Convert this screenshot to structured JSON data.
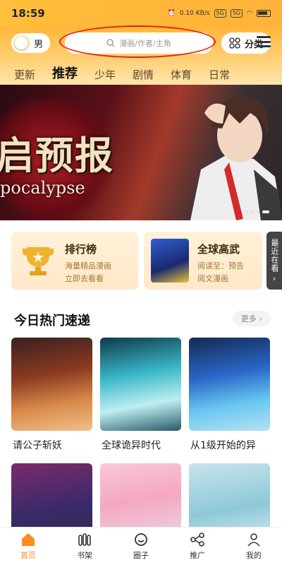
{
  "status": {
    "time": "18:59",
    "net_speed": "0.10 KB/s",
    "sig1": "5G",
    "sig2": "5G"
  },
  "header": {
    "gender_label": "男",
    "search_placeholder": "漫画/作者/主角",
    "category_label": "分类"
  },
  "tabs": [
    {
      "label": "更新"
    },
    {
      "label": "推荐"
    },
    {
      "label": "少年"
    },
    {
      "label": "剧情"
    },
    {
      "label": "体育"
    },
    {
      "label": "日常"
    }
  ],
  "banner": {
    "title": "启预报",
    "subtitle": "pocalypse"
  },
  "cards": {
    "ranking": {
      "title": "排行榜",
      "line1": "海量精品漫画",
      "line2": "立即去看看"
    },
    "promo": {
      "title": "全球高武",
      "line1": "阅读至：预告",
      "line2": "阅文漫画"
    },
    "recent_label": "最近在看"
  },
  "section": {
    "title": "今日热门速递",
    "more_label": "更多"
  },
  "comics": [
    {
      "title": "请公子斩妖"
    },
    {
      "title": "全球诡异时代"
    },
    {
      "title": "从1级开始的异"
    },
    {
      "title": ""
    },
    {
      "title": ""
    },
    {
      "title": ""
    }
  ],
  "nav": [
    {
      "label": "首页",
      "active": true
    },
    {
      "label": "书架"
    },
    {
      "label": "圈子"
    },
    {
      "label": "推广"
    },
    {
      "label": "我的"
    }
  ],
  "colors": {
    "accent": "#ff8a1e",
    "header_top": "#ffb63a",
    "annotation_ring": "#e2231a"
  }
}
